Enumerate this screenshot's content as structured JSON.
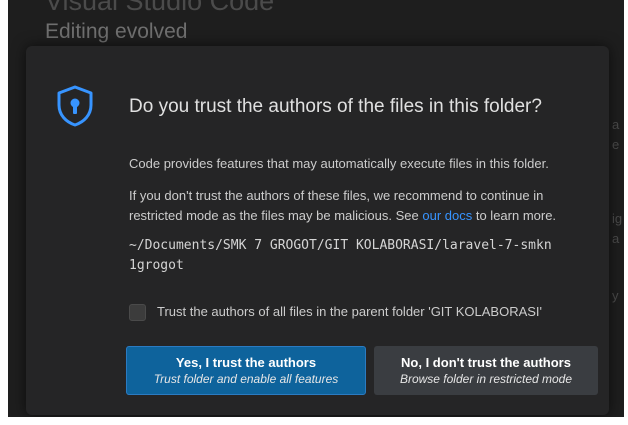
{
  "background": {
    "heading": "Visual Studio Code",
    "subheading": "Editing evolved",
    "edge_letters": [
      "a",
      "e",
      "ig",
      "a",
      "y"
    ]
  },
  "dialog": {
    "title": "Do you trust the authors of the files in this folder?",
    "paragraph1": "Code provides features that may automatically execute files in this folder.",
    "paragraph2_before_link": "If you don't trust the authors of these files, we recommend to continue in restricted mode as the files may be malicious. See ",
    "link_text": "our docs",
    "paragraph2_after_link": " to learn more.",
    "folder_path": "~/Documents/SMK 7 GROGOT/GIT KOLABORASI/laravel-7-smkn1grogot",
    "checkbox_label": "Trust the authors of all files in the parent folder 'GIT KOLABORASI'",
    "checkbox_checked": false,
    "trust_button": {
      "label": "Yes, I trust the authors",
      "sublabel": "Trust folder and enable all features"
    },
    "distrust_button": {
      "label": "No, I don't trust the authors",
      "sublabel": "Browse folder in restricted mode"
    }
  },
  "icons": {
    "dialog_icon": "shield-lock-icon"
  },
  "colors": {
    "accent": "#0e639c",
    "link": "#3794ff",
    "shield": "#3794ff",
    "dialog_bg": "#252526"
  }
}
